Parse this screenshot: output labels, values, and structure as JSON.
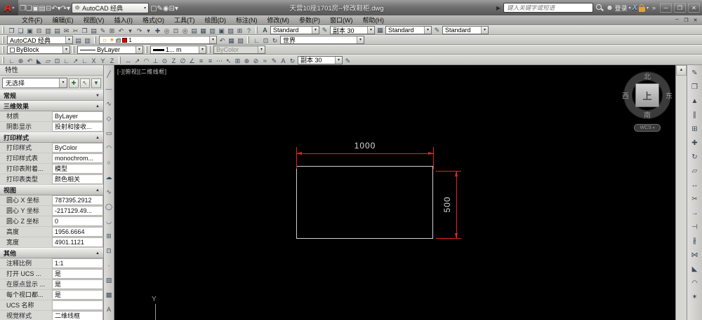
{
  "titlebar": {
    "workspace": "AutoCAD 经典",
    "title": "天营10座1701房--修改鞋柜.dwg",
    "search_placeholder": "键入关键字或短语",
    "signin": "登录",
    "window_buttons": [
      "─",
      "❐",
      "✕"
    ]
  },
  "menubar": {
    "items": [
      "文件(F)",
      "编辑(E)",
      "视图(V)",
      "插入(I)",
      "格式(O)",
      "工具(T)",
      "绘图(D)",
      "标注(N)",
      "修改(M)",
      "参数(P)",
      "窗口(W)",
      "帮助(H)"
    ],
    "window_buttons": [
      "─",
      "❐",
      "✕"
    ]
  },
  "toolbars": {
    "text_style": "Standard",
    "dim_style": "副本 30",
    "table_style": "Standard",
    "mleader_style": "Standard",
    "workspace": "AutoCAD 经典",
    "current_layer": "1",
    "view": "世界",
    "color": "ByBlock",
    "linetype": "ByLayer",
    "lineweight": "1... m",
    "plot_style": "ByColor",
    "dim_toolbar_style": "副本 30"
  },
  "palette": {
    "title": "特性",
    "selection": "无选择",
    "sections": [
      {
        "label": "常规",
        "expanded": false,
        "rows": []
      },
      {
        "label": "三维效果",
        "expanded": true,
        "rows": [
          [
            "材质",
            "ByLayer"
          ],
          [
            "阴影显示",
            "投射和接收..."
          ]
        ]
      },
      {
        "label": "打印样式",
        "expanded": true,
        "rows": [
          [
            "打印样式",
            "ByColor"
          ],
          [
            "打印样式表",
            "monochrom..."
          ],
          [
            "打印表附着...",
            "模型"
          ],
          [
            "打印表类型",
            "颜色相关"
          ]
        ]
      },
      {
        "label": "视图",
        "expanded": true,
        "rows": [
          [
            "圆心 X 坐标",
            "787395.2912"
          ],
          [
            "圆心 Y 坐标",
            "-217129.49..."
          ],
          [
            "圆心 Z 坐标",
            "0"
          ],
          [
            "高度",
            "1956.6664"
          ],
          [
            "宽度",
            "4901.1121"
          ]
        ]
      },
      {
        "label": "其他",
        "expanded": true,
        "rows": [
          [
            "注释比例",
            "1:1"
          ],
          [
            "打开 UCS ...",
            "是"
          ],
          [
            "在原点显示 ...",
            "是"
          ],
          [
            "每个视口都...",
            "是"
          ],
          [
            "UCS 名称",
            ""
          ],
          [
            "视觉样式",
            "二维线框"
          ]
        ]
      }
    ]
  },
  "canvas": {
    "viewport_label": "[-][俯视][二维线框]",
    "viewcube": {
      "north": "北",
      "south": "南",
      "west": "西",
      "east": "东",
      "top": "上",
      "wcs": "WCS"
    },
    "dims": {
      "width": "1000",
      "height": "500"
    },
    "ucs_axis": "Y",
    "colors": {
      "dimension": "#e42222",
      "geometry": "#cfcfcf",
      "dim_text": "#d8d8d8",
      "background": "#000000"
    }
  },
  "icons": {
    "quick_access": [
      {
        "n": "new-file-icon",
        "g": "❐"
      },
      {
        "n": "open-file-icon",
        "g": "❑"
      },
      {
        "n": "save-icon",
        "g": "▣"
      },
      {
        "n": "save-as-icon",
        "g": "▤"
      },
      {
        "n": "plot-icon",
        "g": "⊟"
      },
      {
        "n": "undo-icon",
        "g": "↶"
      },
      {
        "n": "undo-caret-icon",
        "g": "▾"
      },
      {
        "n": "redo-icon",
        "g": "↷"
      },
      {
        "n": "redo-caret-icon",
        "g": "▾"
      }
    ],
    "quick_access2": [
      {
        "n": "render-icon",
        "g": "▢"
      },
      {
        "n": "sketch-icon",
        "g": "✎"
      },
      {
        "n": "view-icon",
        "g": "◉"
      },
      {
        "n": "batch-plot-icon",
        "g": "⊟"
      },
      {
        "n": "qat-menu-caret-icon",
        "g": "▾"
      }
    ],
    "standard": [
      {
        "n": "new-icon",
        "g": "❐"
      },
      {
        "n": "open-icon",
        "g": "❑"
      },
      {
        "n": "save-icon",
        "g": "▣"
      },
      {
        "n": "plot-icon",
        "g": "⊟"
      },
      {
        "n": "plot-preview-icon",
        "g": "▥"
      },
      {
        "n": "publish-icon",
        "g": "▤"
      },
      {
        "n": "etransmit-icon",
        "g": "✉"
      },
      {
        "n": "cut-icon",
        "g": "✂"
      },
      {
        "n": "copy-clip-icon",
        "g": "❐"
      },
      {
        "n": "paste-icon",
        "g": "▤"
      },
      {
        "n": "match-properties-icon",
        "g": "✎"
      },
      {
        "n": "block-editor-icon",
        "g": "⊞"
      },
      {
        "n": "undo-icon",
        "g": "↶"
      },
      {
        "n": "undo-caret-icon",
        "g": "▾"
      },
      {
        "n": "redo-icon",
        "g": "↷"
      },
      {
        "n": "redo-caret-icon",
        "g": "▾"
      },
      {
        "n": "pan-icon",
        "g": "✚"
      },
      {
        "n": "zoom-realtime-icon",
        "g": "◎"
      },
      {
        "n": "zoom-window-icon",
        "g": "⊡"
      },
      {
        "n": "zoom-previous-icon",
        "g": "◎"
      },
      {
        "n": "properties-icon",
        "g": "▤"
      },
      {
        "n": "designcenter-icon",
        "g": "▦"
      },
      {
        "n": "tool-palettes-icon",
        "g": "▥"
      },
      {
        "n": "sheet-set-icon",
        "g": "▣"
      },
      {
        "n": "markup-icon",
        "g": "▧"
      },
      {
        "n": "quickcalc-icon",
        "g": "⊞"
      },
      {
        "n": "help-icon",
        "g": "?"
      }
    ],
    "layer_pre": [
      {
        "n": "layer-properties-icon",
        "g": "▤"
      },
      {
        "n": "layer-states-icon",
        "g": "▥"
      }
    ],
    "layer_post": [
      {
        "n": "layer-previous-icon",
        "g": "↶"
      },
      {
        "n": "layer-isolate-icon",
        "g": "▦"
      },
      {
        "n": "layer-unisolate-icon",
        "g": "▧"
      }
    ],
    "ucs_mini": [
      {
        "n": "ucs-icon",
        "g": "∟"
      },
      {
        "n": "ucs-world-icon",
        "g": "⊡"
      },
      {
        "n": "named-views-icon",
        "g": "↻"
      }
    ],
    "ucs_bar": [
      {
        "n": "ucs-icon",
        "g": "∟"
      },
      {
        "n": "world-ucs-icon",
        "g": "⊕"
      },
      {
        "n": "ucs-previous-icon",
        "g": "↶"
      },
      {
        "n": "face-ucs-icon",
        "g": "◣"
      },
      {
        "n": "object-ucs-icon",
        "g": "▱"
      },
      {
        "n": "view-ucs-icon",
        "g": "⊡"
      },
      {
        "n": "origin-ucs-icon",
        "g": "∟"
      },
      {
        "n": "zaxis-ucs-icon",
        "g": "↗"
      },
      {
        "n": "threepoint-ucs-icon",
        "g": "∟"
      },
      {
        "n": "x-rotate-icon",
        "g": "X"
      },
      {
        "n": "y-rotate-icon",
        "g": "Y"
      },
      {
        "n": "z-rotate-icon",
        "g": "Z"
      }
    ],
    "dim_bar": [
      {
        "n": "dim-linear-icon",
        "g": "↔"
      },
      {
        "n": "dim-aligned-icon",
        "g": "↗"
      },
      {
        "n": "dim-arclength-icon",
        "g": "◠"
      },
      {
        "n": "dim-ordinate-icon",
        "g": "⊥"
      },
      {
        "n": "dim-radius-icon",
        "g": "⊙"
      },
      {
        "n": "dim-jogged-icon",
        "g": "Z"
      },
      {
        "n": "dim-diameter-icon",
        "g": "∅"
      },
      {
        "n": "dim-angular-icon",
        "g": "∠"
      },
      {
        "n": "dim-quick-icon",
        "g": "≡"
      },
      {
        "n": "dim-baseline-icon",
        "g": "≡"
      },
      {
        "n": "dim-continue-icon",
        "g": "⋯"
      },
      {
        "n": "dim-leader-icon",
        "g": "↖"
      },
      {
        "n": "dim-tolerance-icon",
        "g": "⊞"
      },
      {
        "n": "dim-centermark-icon",
        "g": "⊕"
      },
      {
        "n": "dim-inspect-icon",
        "g": "⊘"
      },
      {
        "n": "dim-jogline-icon",
        "g": "≈"
      },
      {
        "n": "dim-edit-icon",
        "g": "✎"
      },
      {
        "n": "dim-textedit-icon",
        "g": "A"
      },
      {
        "n": "dim-update-icon",
        "g": "↻"
      }
    ],
    "dim_bar_end": [
      {
        "n": "dim-style-manager-icon",
        "g": "✎"
      }
    ],
    "styles_icons": [
      {
        "n": "text-style-icon",
        "g": "A"
      },
      {
        "n": "dim-style-icon",
        "g": "✎"
      },
      {
        "n": "table-style-icon",
        "g": "▦"
      },
      {
        "n": "mleader-style-icon",
        "g": "✎"
      }
    ],
    "draw_bar": [
      {
        "n": "line-icon",
        "g": "╱"
      },
      {
        "n": "construction-line-icon",
        "g": "―"
      },
      {
        "n": "polyline-icon",
        "g": "∿"
      },
      {
        "n": "polygon-icon",
        "g": "◇"
      },
      {
        "n": "rectangle-icon",
        "g": "▭"
      },
      {
        "n": "arc-icon",
        "g": "◠"
      },
      {
        "n": "circle-icon",
        "g": "○"
      },
      {
        "n": "revcloud-icon",
        "g": "☁"
      },
      {
        "n": "spline-icon",
        "g": "∿"
      },
      {
        "n": "ellipse-icon",
        "g": "◯"
      },
      {
        "n": "ellipse-arc-icon",
        "g": "◡"
      },
      {
        "n": "insert-block-icon",
        "g": "⊞"
      },
      {
        "n": "make-block-icon",
        "g": "⊡"
      },
      {
        "n": "point-icon",
        "g": "∙"
      },
      {
        "n": "hatch-icon",
        "g": "▨"
      },
      {
        "n": "gradient-icon",
        "g": "▩"
      },
      {
        "n": "mtext-icon",
        "g": "A"
      }
    ],
    "modify_bar": [
      {
        "n": "erase-icon",
        "g": "✎"
      },
      {
        "n": "copy-icon",
        "g": "❐"
      },
      {
        "n": "mirror-icon",
        "g": "▲"
      },
      {
        "n": "offset-icon",
        "g": "∥"
      },
      {
        "n": "array-icon",
        "g": "⊞"
      },
      {
        "n": "move-icon",
        "g": "✚"
      },
      {
        "n": "rotate-icon",
        "g": "↻"
      },
      {
        "n": "scale-icon",
        "g": "▱"
      },
      {
        "n": "stretch-icon",
        "g": "↔"
      },
      {
        "n": "trim-icon",
        "g": "✂"
      },
      {
        "n": "extend-icon",
        "g": "→"
      },
      {
        "n": "break-at-point-icon",
        "g": "⊣"
      },
      {
        "n": "break-icon",
        "g": "∦"
      },
      {
        "n": "join-icon",
        "g": "⋈"
      },
      {
        "n": "chamfer-icon",
        "g": "◣"
      },
      {
        "n": "fillet-icon",
        "g": "◠"
      },
      {
        "n": "explode-icon",
        "g": "✶"
      }
    ],
    "palette_buttons": [
      {
        "n": "toggle-pickadd-icon",
        "g": "✚"
      },
      {
        "n": "select-objects-icon",
        "g": "↖"
      },
      {
        "n": "quick-select-icon",
        "g": "▼"
      }
    ]
  }
}
